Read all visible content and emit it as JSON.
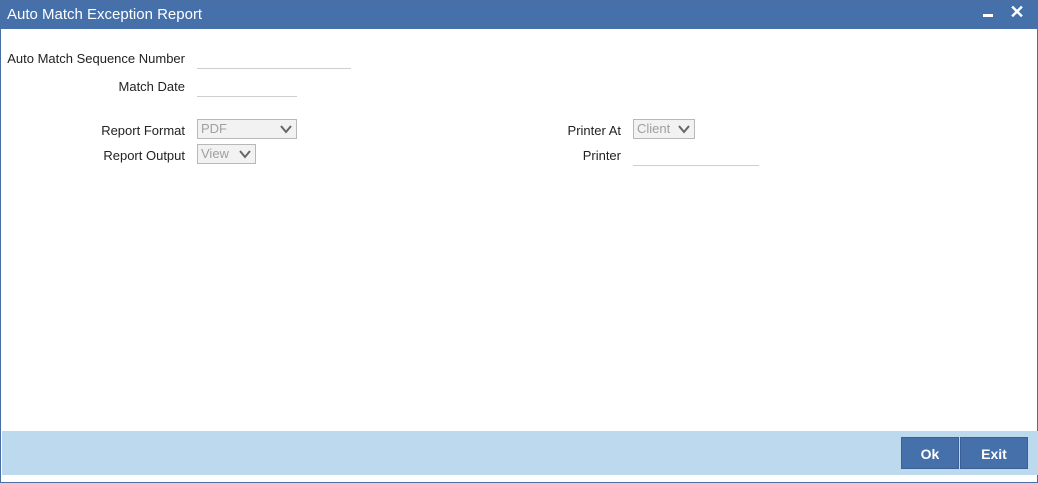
{
  "window": {
    "title": "Auto Match Exception Report",
    "minimize_icon": "minimize-icon",
    "close_icon": "close-icon",
    "close_glyph": "✕"
  },
  "form": {
    "sequence_number": {
      "label": "Auto Match Sequence Number",
      "value": ""
    },
    "match_date": {
      "label": "Match Date",
      "value": ""
    },
    "report_format": {
      "label": "Report Format",
      "selected": "PDF"
    },
    "report_output": {
      "label": "Report Output",
      "selected": "View"
    },
    "printer_at": {
      "label": "Printer At",
      "selected": "Client"
    },
    "printer": {
      "label": "Printer",
      "value": ""
    }
  },
  "footer": {
    "ok_label": "Ok",
    "exit_label": "Exit"
  },
  "colors": {
    "titlebar": "#4670aa",
    "footer": "#bcd9ee",
    "button": "#4670aa"
  }
}
